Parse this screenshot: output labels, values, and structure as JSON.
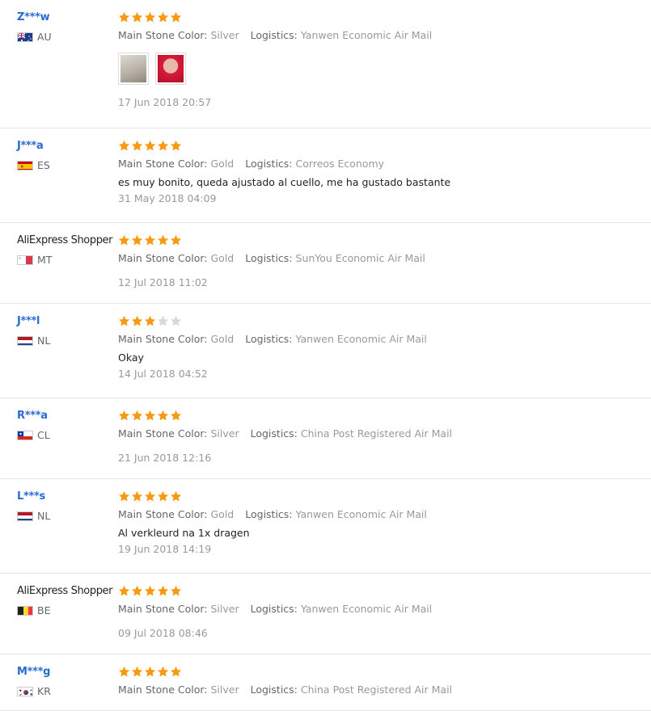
{
  "labels": {
    "stone": "Main Stone Color:",
    "logistics": "Logistics:"
  },
  "colors": {
    "link_blue": "#2a6bd2",
    "star_on": "#f79a12",
    "star_off": "#d9d9d9"
  },
  "reviews": [
    {
      "user": "Z***w",
      "shopper": false,
      "country": "AU",
      "flag": "flag-au-icon",
      "rating": 5,
      "stone": "Silver",
      "logistics": "Yanwen Economic Air Mail",
      "text": "",
      "images": [
        "photo-thumb",
        "photo-thumb"
      ],
      "date": "17 Jun 2018 20:57"
    },
    {
      "user": "J***a",
      "shopper": false,
      "country": "ES",
      "flag": "flag-es-icon",
      "rating": 5,
      "stone": "Gold",
      "logistics": "Correos Economy",
      "text": "es muy bonito, queda ajustado al cuello, me ha gustado bastante",
      "images": [],
      "date": "31 May 2018 04:09"
    },
    {
      "user": "AliExpress Shopper",
      "shopper": true,
      "country": "MT",
      "flag": "flag-mt-icon",
      "rating": 5,
      "stone": "Gold",
      "logistics": "SunYou Economic Air Mail",
      "text": "",
      "images": [],
      "date": "12 Jul 2018 11:02"
    },
    {
      "user": "J***l",
      "shopper": false,
      "country": "NL",
      "flag": "flag-nl-icon",
      "rating": 3,
      "stone": "Gold",
      "logistics": "Yanwen Economic Air Mail",
      "text": "Okay",
      "images": [],
      "date": "14 Jul 2018 04:52"
    },
    {
      "user": "R***a",
      "shopper": false,
      "country": "CL",
      "flag": "flag-cl-icon",
      "rating": 5,
      "stone": "Silver",
      "logistics": "China Post Registered Air Mail",
      "text": "",
      "images": [],
      "date": "21 Jun 2018 12:16"
    },
    {
      "user": "L***s",
      "shopper": false,
      "country": "NL",
      "flag": "flag-nl-icon",
      "rating": 5,
      "stone": "Gold",
      "logistics": "Yanwen Economic Air Mail",
      "text": "Al verkleurd na 1x dragen",
      "images": [],
      "date": "19 Jun 2018 14:19"
    },
    {
      "user": "AliExpress Shopper",
      "shopper": true,
      "country": "BE",
      "flag": "flag-be-icon",
      "rating": 5,
      "stone": "Silver",
      "logistics": "Yanwen Economic Air Mail",
      "text": "",
      "images": [],
      "date": "09 Jul 2018 08:46"
    },
    {
      "user": "M***g",
      "shopper": false,
      "country": "KR",
      "flag": "flag-kr-icon",
      "rating": 5,
      "stone": "Silver",
      "logistics": "China Post Registered Air Mail",
      "text": "",
      "images": [],
      "date": ""
    }
  ]
}
